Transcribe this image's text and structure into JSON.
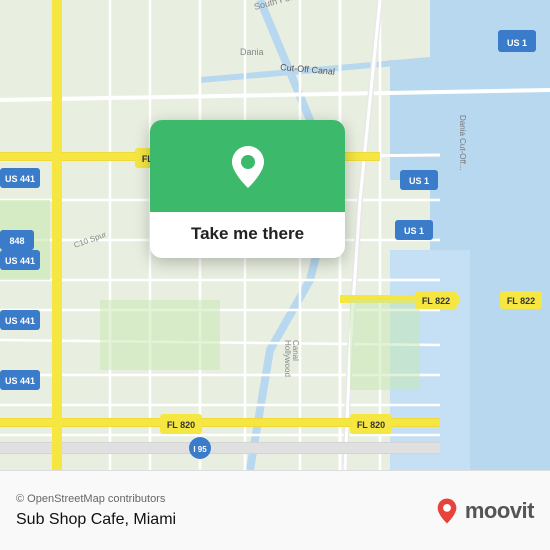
{
  "map": {
    "attribution": "© OpenStreetMap contributors",
    "background_color": "#e8f0e8"
  },
  "card": {
    "button_label": "Take me there",
    "pin_icon": "location-pin"
  },
  "bottom_bar": {
    "copyright": "© OpenStreetMap contributors",
    "location_name": "Sub Shop Cafe, Miami",
    "moovit_label": "moovit"
  },
  "colors": {
    "card_green": "#3cb96a",
    "moovit_pin_red": "#e8433a",
    "road_yellow": "#f5e642",
    "highway_blue": "#3a7cc9",
    "water_blue": "#b0d4f0",
    "land_green": "#d4eacb",
    "road_white": "#ffffff"
  }
}
